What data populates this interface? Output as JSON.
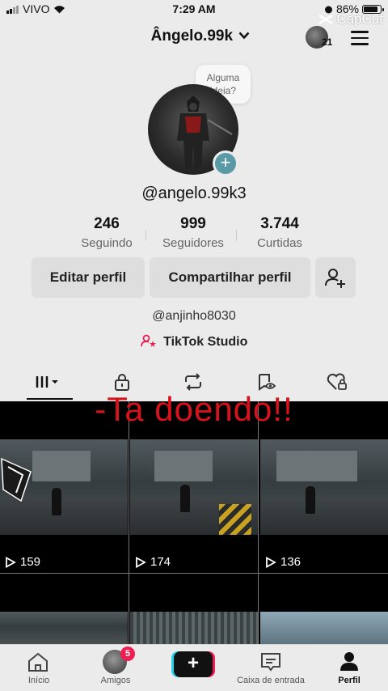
{
  "status_bar": {
    "carrier": "VIVO",
    "time": "7:29 AM",
    "battery": "86%",
    "battery_level": 0.86
  },
  "watermark": "CapCut",
  "header": {
    "username": "Ângelo.99k",
    "avatar_count": "21"
  },
  "profile": {
    "suggestion_bubble": "Alguma ideia?",
    "handle": "@angelo.99k3",
    "stats": [
      {
        "value": "246",
        "label": "Seguindo"
      },
      {
        "value": "999",
        "label": "Seguidores"
      },
      {
        "value": "3.744",
        "label": "Curtidas"
      }
    ],
    "buttons": {
      "edit": "Editar perfil",
      "share": "Compartilhar perfil"
    },
    "alt_account": "@anjinho8030",
    "studio": "TikTok Studio"
  },
  "overlay_caption": "-Ta doendo!!",
  "videos": [
    {
      "views": "159"
    },
    {
      "views": "174"
    },
    {
      "views": "136"
    }
  ],
  "nav": {
    "home": "Início",
    "friends": "Amigos",
    "friends_badge": "5",
    "inbox": "Caixa de entrada",
    "profile": "Perfil"
  },
  "colors": {
    "accent_red": "#ee1d52",
    "accent_cyan": "#22d3ee",
    "caption_red": "#d8121a",
    "add_button": "#5a9aa6"
  }
}
